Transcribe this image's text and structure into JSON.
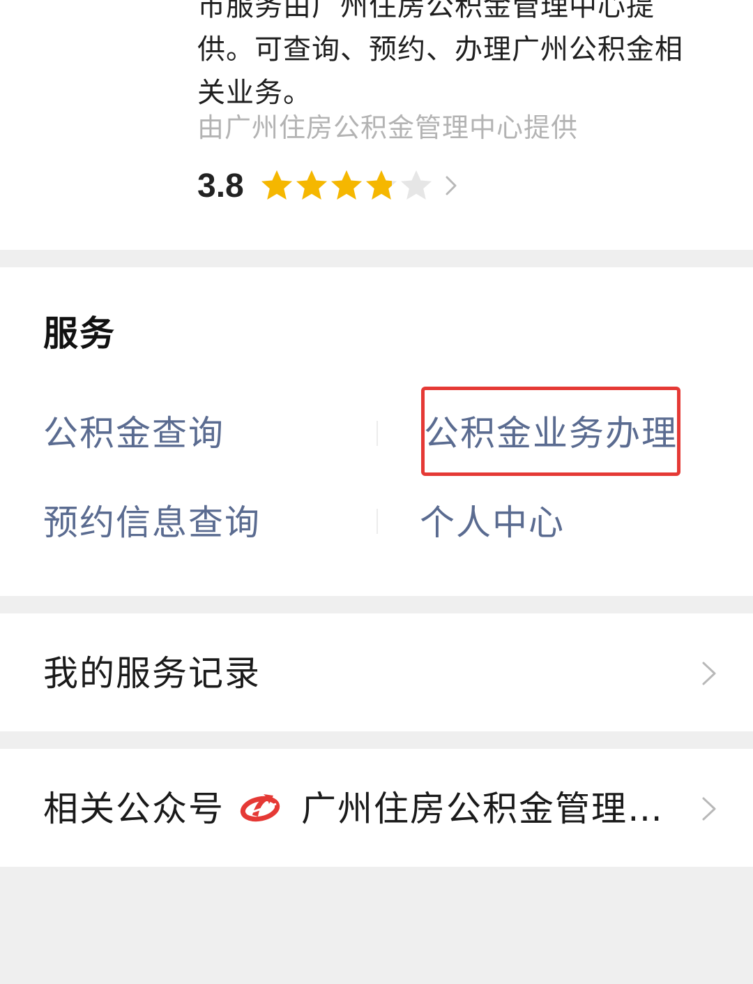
{
  "app_info": {
    "description_lines": [
      "市服务由广州住房公积金管理中心提",
      "供。可查询、预约、办理广州公积金相",
      "关业务。"
    ],
    "provider": "由广州住房公积金管理中心提供",
    "rating": {
      "score": "3.8",
      "value": 3.8,
      "max": 5,
      "star_color": "#f5b700",
      "empty_star_color": "#e6e6e6"
    }
  },
  "services": {
    "title": "服务",
    "items": [
      {
        "label": "公积金查询"
      },
      {
        "label": "公积金业务办理",
        "highlighted": true
      },
      {
        "label": "预约信息查询"
      },
      {
        "label": "个人中心"
      }
    ],
    "link_color": "#5a6b90",
    "highlight_color": "#e53935"
  },
  "records": {
    "label": "我的服务记录"
  },
  "official_account": {
    "label": "相关公众号",
    "name": "广州住房公积金管理…",
    "logo_icon": "housing-fund-logo-icon",
    "logo_color": "#e53935"
  }
}
